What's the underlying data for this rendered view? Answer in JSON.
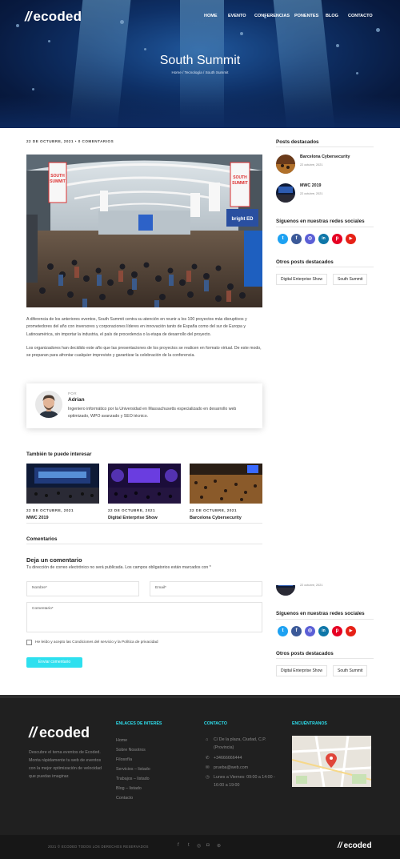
{
  "brand": {
    "name": "ecoded",
    "slash": "//"
  },
  "nav": {
    "items": [
      "HOME",
      "EVENTO",
      "CONFERENCIAS",
      "PONENTES",
      "BLOG",
      "CONTACTO"
    ]
  },
  "hero": {
    "title": "South Summit",
    "breadcrumb": "Home / Tecnología / South Summit"
  },
  "post": {
    "meta": "22 DE OCTUBRE, 2021 • 0 COMENTARIOS",
    "banner_texts": {
      "left": "SOUTH SUMMIT",
      "right": "SOUTH SUMMIT",
      "badge": "bright ED",
      "side": "Pitch Area"
    },
    "paragraph1": "A diferencia de los anteriores eventos, South Summit centra su atención en reunir a los 100 proyectos más disruptivos y prometedores del año con inversores y corporaciones líderes en innovación tanto de España como del sur de Europa y Latinoamérica, sin importar la industria, el país de procedencia o la etapa de desarrollo del proyecto.",
    "paragraph2": "Los organizadores han decidido este año que las presentaciones de los proyectos se realicen en formato virtual. De este modo, se preparan para afrontar cualquier imprevisto y garantizar la celebración de la conferencia."
  },
  "author": {
    "label": "POR",
    "name": "Adrian",
    "bio": "Ingeniero informático por la Universidad en Massachusetts especializado en desarrollo web optimizado, WPO avanzado y SEO técnico."
  },
  "related": {
    "title": "También te puede interesar",
    "items": [
      {
        "date": "22 DE OCTUBRE, 2021",
        "title": "MWC 2019"
      },
      {
        "date": "22 DE OCTUBRE, 2021",
        "title": "Digital Enterprise Show"
      },
      {
        "date": "22 DE OCTUBRE, 2021",
        "title": "Barcelona Cybersecurity"
      }
    ]
  },
  "comments": {
    "title": "Comentarios",
    "leave_title": "Deja un comentario",
    "notice": "Tu dirección de correo electrónico no será publicada. Los campos obligatorios están marcados con *",
    "name_placeholder": "Nombre*",
    "email_placeholder": "Email*",
    "comment_placeholder": "Comentario*",
    "privacy": "He leído y acepto las Condiciones del servicio y la Política de privacidad",
    "submit": "Enviar comentario"
  },
  "sidebar": {
    "featured_title": "Posts destacados",
    "posts": [
      {
        "title": "Barcelona Cybersecurity",
        "date": "22 octubre, 2021"
      },
      {
        "title": "MWC 2019",
        "date": "22 octubre, 2021"
      }
    ],
    "social_title": "Síguenos en nuestras redes sociales",
    "social": [
      {
        "icon": "twitter-icon",
        "glyph": "t",
        "color": "#1da1f2"
      },
      {
        "icon": "facebook-icon",
        "glyph": "f",
        "color": "#3b5998"
      },
      {
        "icon": "instagram-icon",
        "glyph": "◎",
        "color": "#5b5fd6"
      },
      {
        "icon": "linkedin-icon",
        "glyph": "in",
        "color": "#0e76a8"
      },
      {
        "icon": "pinterest-icon",
        "glyph": "p",
        "color": "#e60023"
      },
      {
        "icon": "youtube-icon",
        "glyph": "▶",
        "color": "#e62117"
      }
    ],
    "other_title": "Otros posts destacados",
    "tags": [
      "Digital Enterprise Show",
      "South Summit"
    ],
    "sticky_date": "22 octubre, 2021"
  },
  "footer": {
    "description": "Descubre el tema eventos de Ecoded. Monta rápidamente tu web de eventos con la mejor optimización de velocidad que puedas imaginar.",
    "links_title": "ENLACES DE INTERÉS",
    "links": [
      "Home",
      "Sobre Nosotros",
      "Filosofía",
      "Servicios – listado",
      "Trabajos – listado",
      "Blog – listado",
      "Contacto"
    ],
    "contact_title": "CONTACTO",
    "address": "C/ De la plaza, Ciudad, C.P. (Provincia)",
    "phone": "+34666666444",
    "email": "prueba@web.com",
    "hours": "Lunes a Viernes: 09:00 a 14:00 - 16:00 a 19:00",
    "find_title": "ENCUÉNTRANOS",
    "copyright": "2021 © ECODED TODOS LOS DERECHOS RESERVADOS"
  },
  "colors": {
    "accent": "#2ee0ef",
    "footer_bg": "#202020"
  }
}
